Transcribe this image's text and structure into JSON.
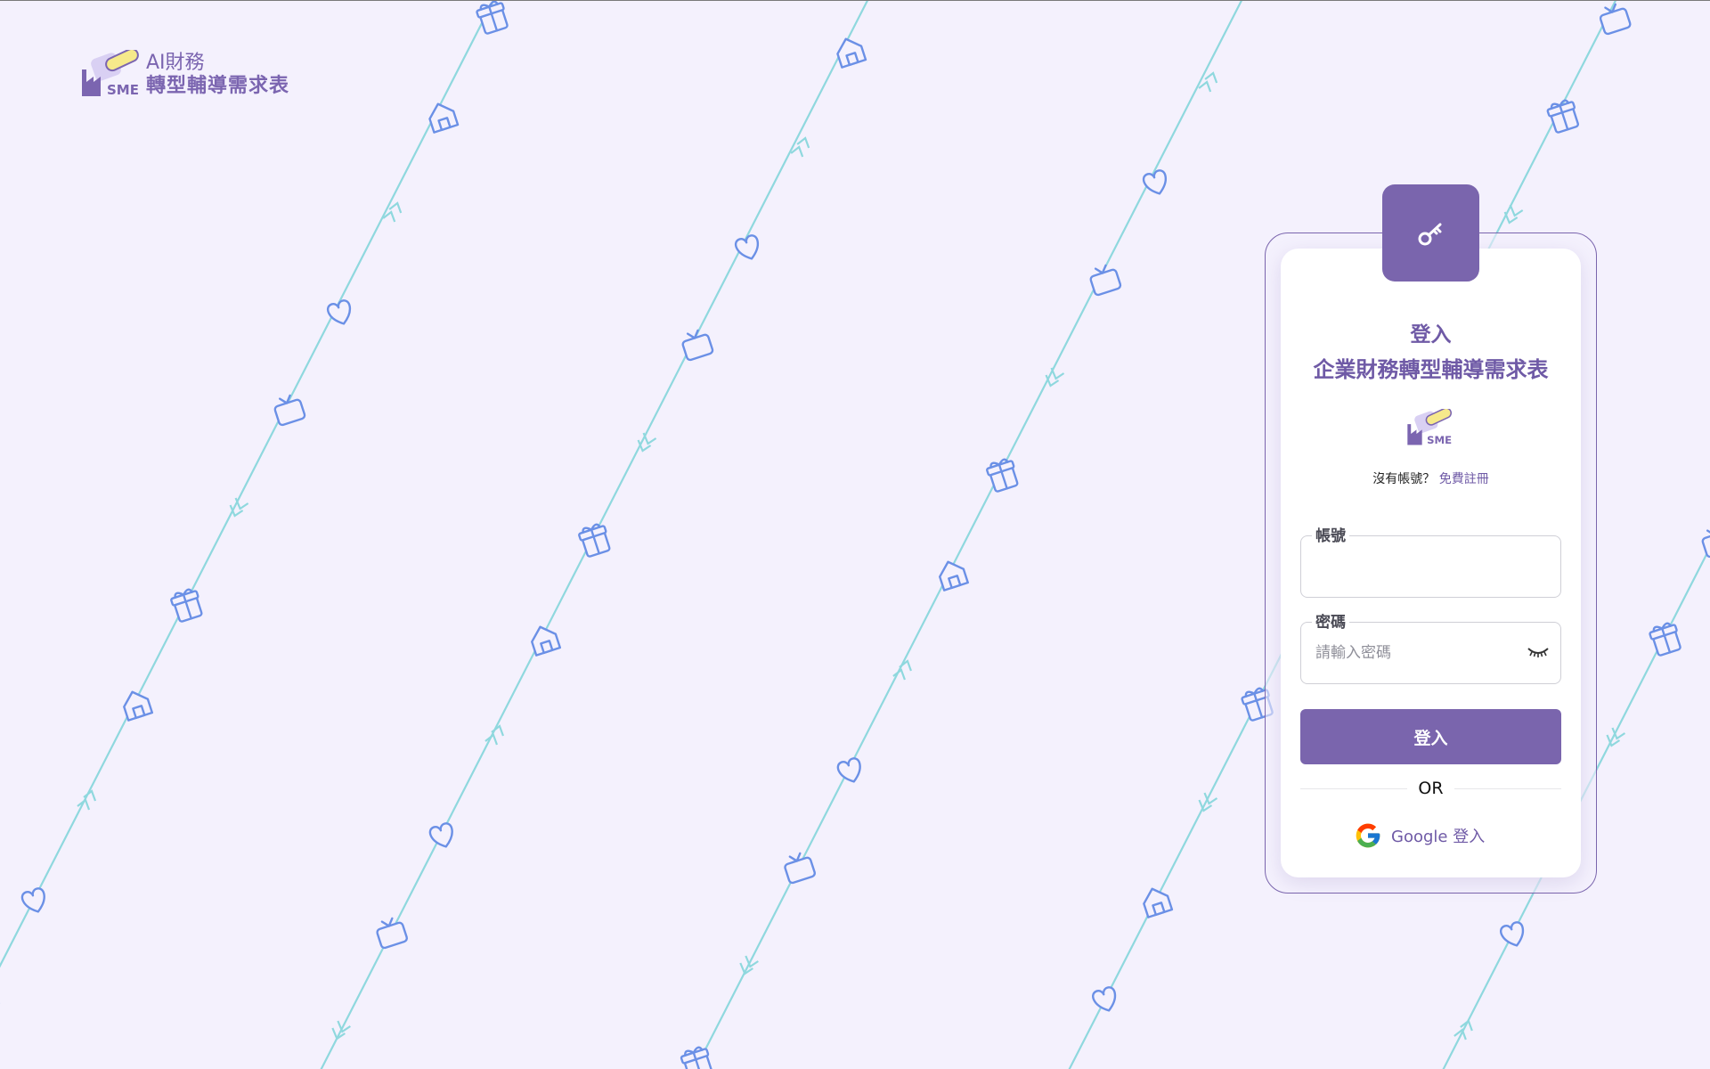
{
  "brand": {
    "logo_text": "SME",
    "line1": "AI財務",
    "line2": "轉型輔導需求表"
  },
  "login_card": {
    "title_line1": "登入",
    "title_line2": "企業財務轉型輔導需求表",
    "key_icon": "key-icon",
    "signup_prompt": "沒有帳號？",
    "signup_link": "免費註冊",
    "username": {
      "label": "帳號",
      "value": "",
      "placeholder": ""
    },
    "password": {
      "label": "密碼",
      "value": "",
      "placeholder": "請輸入密碼",
      "toggle_icon": "eye-closed-icon"
    },
    "login_button": "登入",
    "divider_text": "OR",
    "google_button": "Google 登入"
  },
  "colors": {
    "background": "#f4f1fd",
    "accent": "#7a65ad",
    "pattern_line": "#8fd8de",
    "pattern_icon": "#6b90e6"
  },
  "pattern_icons": [
    "gift-icon",
    "house-icon",
    "heart-icon",
    "tv-icon",
    "chevron-icon"
  ]
}
